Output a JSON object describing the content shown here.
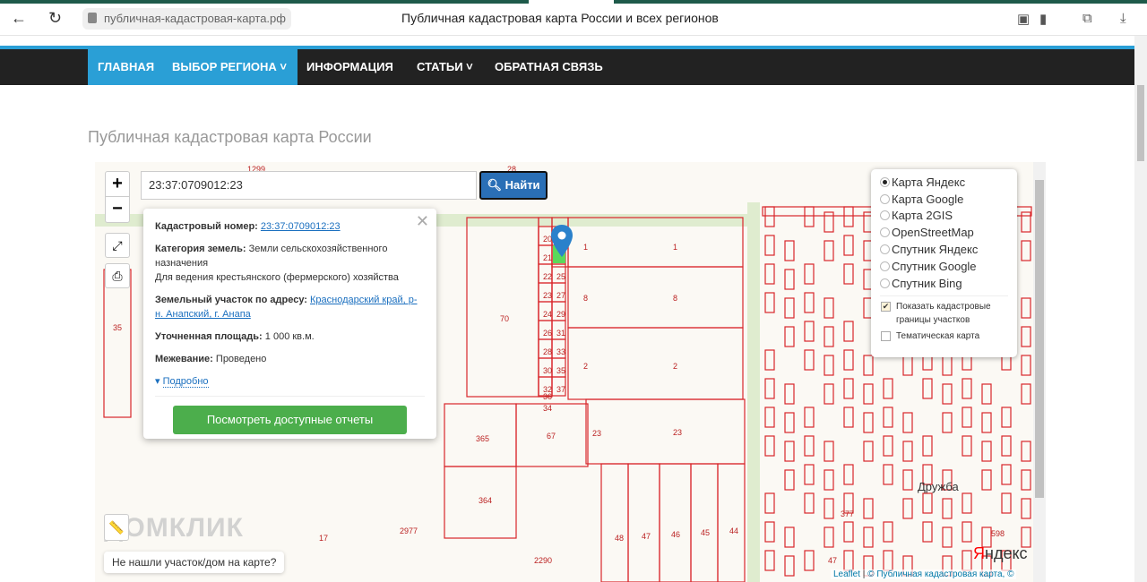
{
  "browser": {
    "url": "публичная-кадастровая-карта.рф",
    "title": "Публичная кадастровая карта России и всех регионов"
  },
  "nav": {
    "items": [
      "ГЛАВНАЯ",
      "ВЫБОР РЕГИОНА ˅",
      "ИНФОРМАЦИЯ",
      "СТАТЬИ ˅",
      "ОБРАТНАЯ СВЯЗЬ"
    ]
  },
  "page": {
    "heading": "Публичная кадастровая карта России"
  },
  "map": {
    "zoom_in": "+",
    "zoom_out": "−",
    "search_value": "23:37:0709012:23",
    "find_label": "Найти",
    "popup": {
      "cad_label": "Кадастровый номер:",
      "cad_value": "23:37:0709012:23",
      "cat_label": "Категория земель:",
      "cat_value": "Земли сельскохозяйственного назначения",
      "use": "Для ведения крестьянского (фермерского) хозяйства",
      "addr_label": "Земельный участок по адресу:",
      "addr_value": "Краснодарский край, р-н. Анапский, г. Анапа",
      "area_label": "Уточненная площадь:",
      "area_value": "1 000 кв.м.",
      "survey_label": "Межевание:",
      "survey_value": "Проведено",
      "more": "Подробно",
      "reports": "Посмотреть доступные отчеты"
    },
    "layers": {
      "options": [
        "Карта Яндекс",
        "Карта Google",
        "Карта 2GIS",
        "OpenStreetMap",
        "Спутник Яндекс",
        "Спутник Google",
        "Спутник Bing"
      ],
      "selected": 0,
      "show_borders": "Показать кадастровые границы участков",
      "thematic": "Тематическая карта"
    },
    "not_found": "Не нашли участок/дом на карте?",
    "attribution_leaflet": "Leaflet",
    "attribution_rest": "© Публичная кадастровая карта, ©",
    "watermark": "ДОМКЛИК",
    "yandex": "Яндекс",
    "place": "Дружба",
    "parcel_labels": [
      "20",
      "21",
      "22",
      "23",
      "24",
      "25",
      "26",
      "27",
      "28",
      "29",
      "30",
      "31",
      "32",
      "33",
      "34",
      "35",
      "36",
      "37",
      "1",
      "1",
      "8",
      "8",
      "2",
      "2",
      "70",
      "365",
      "67",
      "23",
      "23",
      "364",
      "17",
      "2977",
      "2290",
      "48",
      "47",
      "46",
      "45",
      "44",
      "35",
      "1299",
      "28",
      "377",
      "47",
      "598"
    ]
  },
  "colors": {
    "accent": "#2a9fd6",
    "parcel": "#d9262b",
    "green": "#4cae4c"
  }
}
